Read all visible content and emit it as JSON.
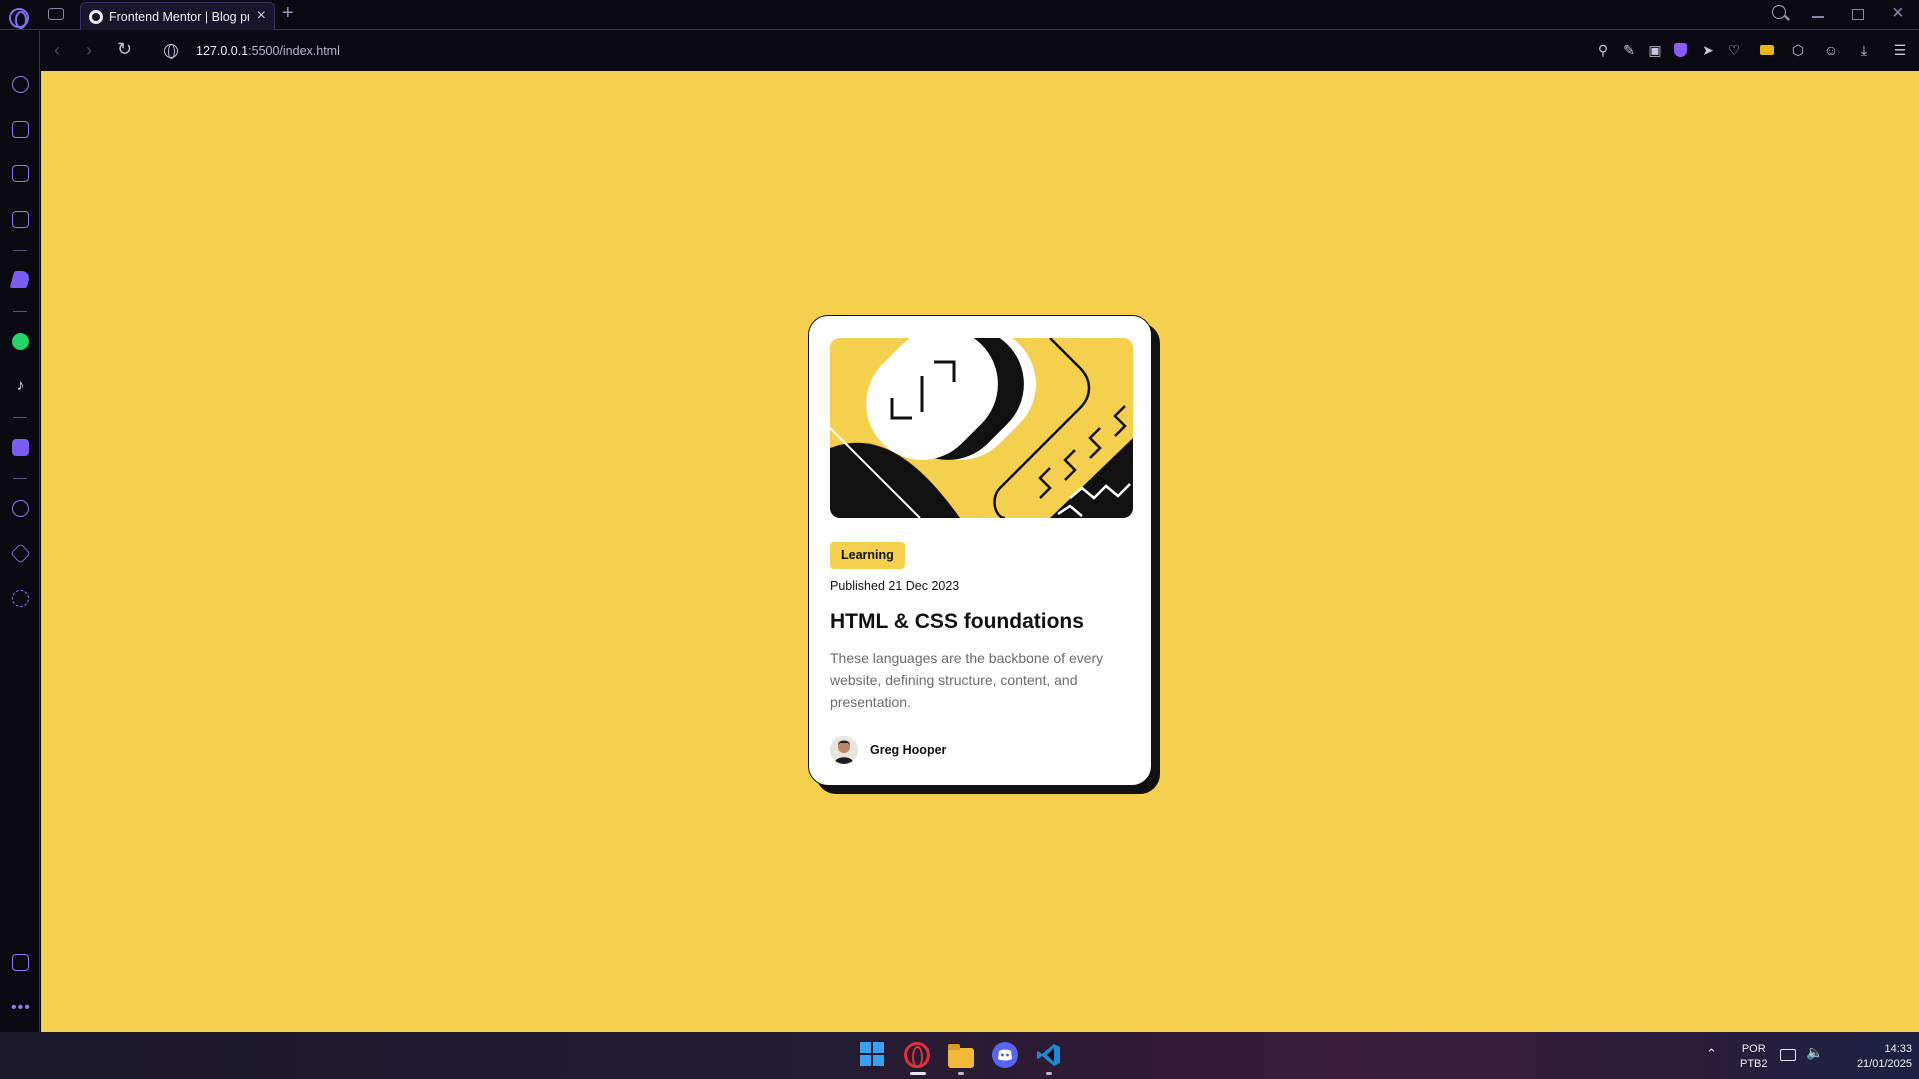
{
  "browser": {
    "tab_title": "Frontend Mentor | Blog preview card",
    "new_tab_symbol": "+",
    "close_symbol": "×",
    "url_host": "127.0.0.1",
    "url_rest": ":5500/index.html"
  },
  "card": {
    "tag": "Learning",
    "published": "Published 21 Dec 2023",
    "title": "HTML & CSS foundations",
    "description": "These languages are the backbone of every website, defining structure, content, and presentation.",
    "author": "Greg Hooper"
  },
  "taskbar": {
    "lang_line1": "POR",
    "lang_line2": "PTB2",
    "time": "14:33",
    "date": "21/01/2025"
  },
  "colors": {
    "page_bg": "#f4d04e",
    "accent": "#7e6ff2",
    "card_shadow": "#111111"
  },
  "icons": {
    "sidebar": [
      "speed-dial-icon",
      "shopping-icon",
      "twitch-icon",
      "history-icon",
      "aria-icon",
      "whatsapp-icon",
      "tiktok-icon",
      "music-player-icon",
      "clock-icon",
      "extensions-icon",
      "settings-icon",
      "gallery-icon",
      "more-icon"
    ],
    "toolbar": [
      "search-icon",
      "edit-icon",
      "camera-icon",
      "vpn-shield-icon",
      "send-icon",
      "heart-icon",
      "wallet-icon",
      "cube-icon",
      "profile-icon",
      "download-icon",
      "menu-icon"
    ]
  }
}
